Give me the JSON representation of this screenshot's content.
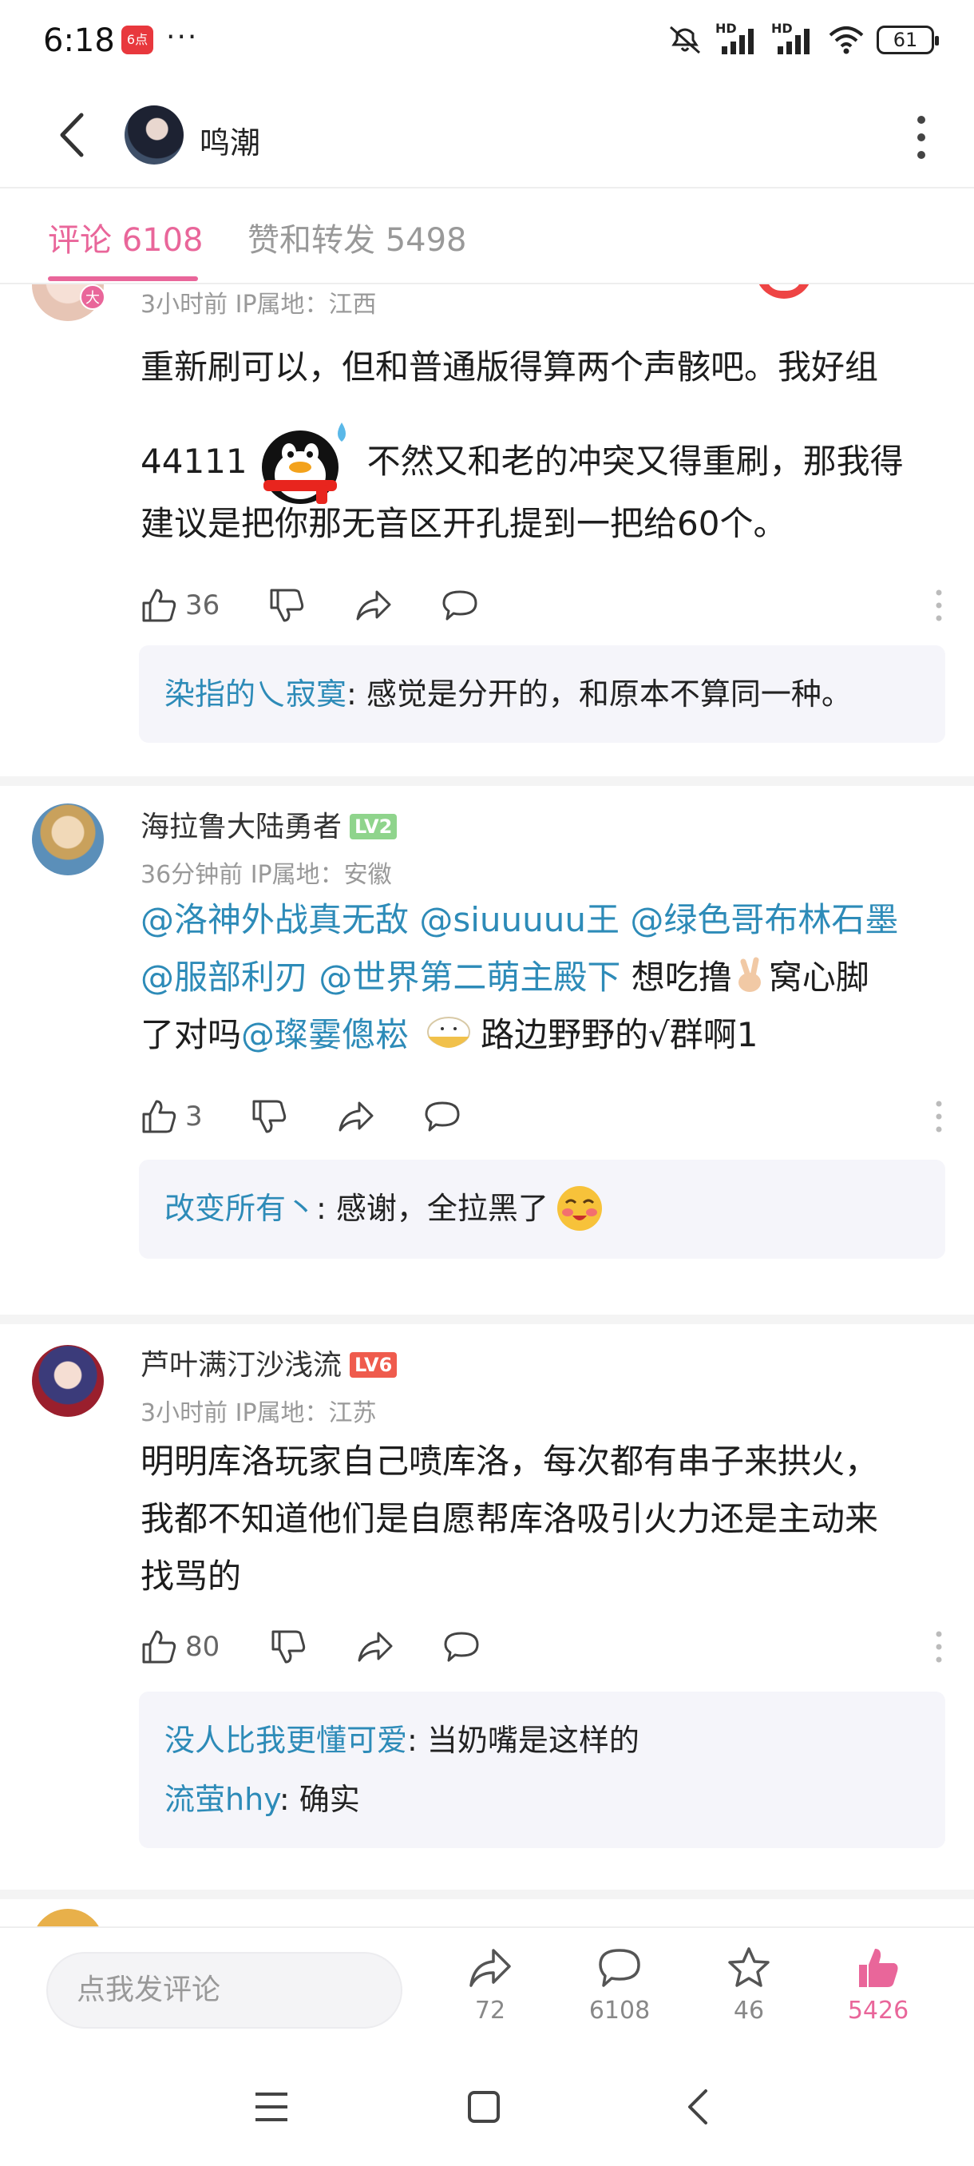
{
  "status": {
    "time": "6:18",
    "app_badge": "6点",
    "dots": "···",
    "net1": "HD",
    "net2": "HD",
    "battery": "61"
  },
  "header": {
    "name": "鸣潮"
  },
  "tabs": {
    "comments": "评论 6108",
    "likes_reposts": "赞和转发 5498"
  },
  "comments": [
    {
      "meta": "3小时前 IP属地：江西",
      "text_line1": "重新刷可以，但和普通版得算两个声骸吧。我好组",
      "text_line2_pre": "44111",
      "text_line2_post": "不然又和老的冲突又得重刷，那我得",
      "text_line3": "建议是把你那无音区开孔提到一把给60个。",
      "likes": "36",
      "replies": [
        {
          "name": "染指的乀寂寞",
          "text": ": 感觉是分开的，和原本不算同一种。"
        }
      ]
    },
    {
      "name": "海拉鲁大陆勇者",
      "level": "LV2",
      "meta": "36分钟前 IP属地：安徽",
      "mentions": [
        "@洛神外战真无敌",
        "@siuuuuu王",
        "@绿色哥布林石墨",
        "@服部利刃",
        "@世界第二萌主殿下",
        "@璨霎傯崧"
      ],
      "text_a": " 想吃撸",
      "text_b": "窝心脚",
      "text_c": "了对吗",
      "text_d": "路边野野的√群啊1",
      "likes": "3",
      "replies": [
        {
          "name": "改变所有丶",
          "text": ": 感谢，全拉黑了"
        }
      ]
    },
    {
      "name": "芦叶满汀沙浅流",
      "level": "LV6",
      "meta": "3小时前 IP属地：江苏",
      "text_line1": "明明库洛玩家自己喷库洛，每次都有串子来拱火，",
      "text_line2": "我都不知道他们是自愿帮库洛吸引火力还是主动来",
      "text_line3": "找骂的",
      "likes": "80",
      "replies": [
        {
          "name": "没人比我更懂可爱",
          "text": ": 当奶嘴是这样的"
        },
        {
          "name": "流萤hhy",
          "text": ": 确实"
        }
      ]
    }
  ],
  "bottom": {
    "input_placeholder": "点我发评论",
    "share": "72",
    "comment": "6108",
    "favorite": "46",
    "like": "5426"
  },
  "colors": {
    "accent": "#e9669a",
    "mention": "#2d8bb8",
    "lv2": "#8fd48c",
    "lv6": "#ef5b4d"
  }
}
